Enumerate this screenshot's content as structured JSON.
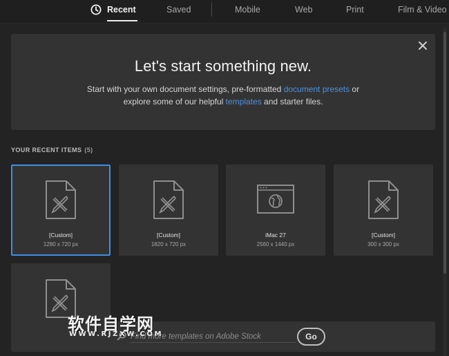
{
  "tabs": {
    "recent": "Recent",
    "saved": "Saved",
    "mobile": "Mobile",
    "web": "Web",
    "print": "Print",
    "film": "Film & Video"
  },
  "banner": {
    "title": "Let's start something new.",
    "line1_prefix": "Start with your own document settings, pre-formatted ",
    "link_presets": "document presets",
    "line1_suffix": " or",
    "line2_prefix": "explore some of our helpful ",
    "link_templates": "templates",
    "line2_suffix": " and starter files."
  },
  "recent": {
    "label": "YOUR RECENT ITEMS",
    "count": "(5)",
    "items": [
      {
        "name": "[Custom]",
        "dims": "1280 x 720 px",
        "icon": "document-draw-icon",
        "selected": true
      },
      {
        "name": "[Custom]",
        "dims": "1820 x 720 px",
        "icon": "document-draw-icon",
        "selected": false
      },
      {
        "name": "iMac 27",
        "dims": "2560 x 1440 px",
        "icon": "web-browser-icon",
        "selected": false
      },
      {
        "name": "[Custom]",
        "dims": "300 x 300 px",
        "icon": "document-draw-icon",
        "selected": false
      },
      {
        "name": "",
        "dims": "",
        "icon": "document-draw-icon",
        "selected": false
      }
    ]
  },
  "search": {
    "placeholder": "Find more templates on Adobe Stock",
    "go_label": "Go"
  },
  "watermark": {
    "title": "软件自学网",
    "url": "WWW.RJZXW.COM"
  },
  "colors": {
    "background": "#232323",
    "panel": "#333333",
    "accent": "#3d8ee8",
    "link": "#4d90e0"
  }
}
